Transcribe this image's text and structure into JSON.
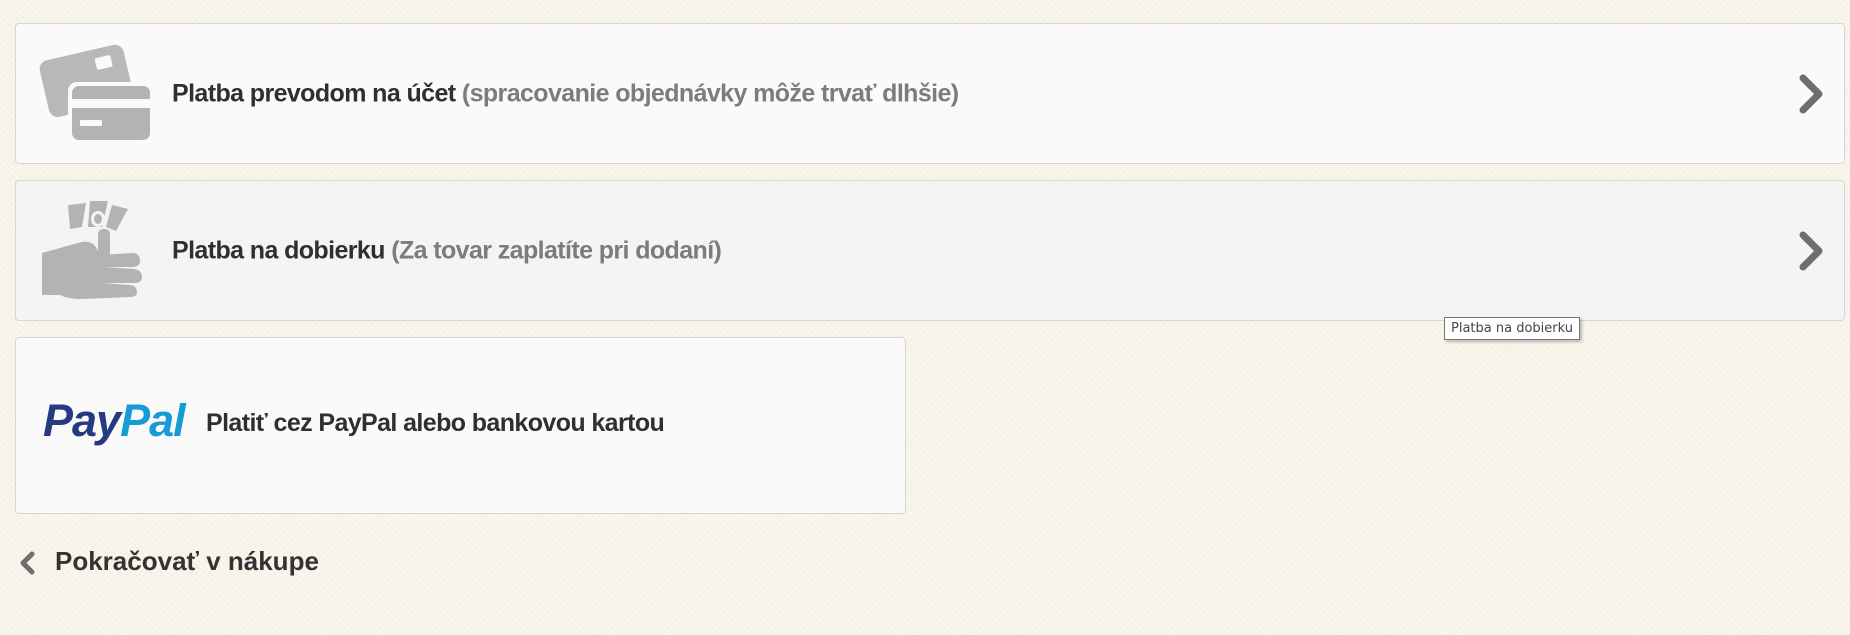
{
  "payment_options": [
    {
      "icon": "credit-card-icon",
      "label": "Platba prevodom na účet",
      "note": "(spracovanie objednávky môže trvať dlhšie)"
    },
    {
      "icon": "cash-hand-icon",
      "label": "Platba na dobierku",
      "note": "(Za tovar zaplatíte pri dodaní)"
    }
  ],
  "paypal": {
    "logo_pay": "Pay",
    "logo_pal": "Pal",
    "label": "Platiť cez PayPal alebo bankovou kartou"
  },
  "tooltip": {
    "text": "Platba na dobierku"
  },
  "back_link": {
    "label": "Pokračovať v nákupe",
    "icon": "chevron-left-icon"
  },
  "colors": {
    "background": "#f8f4ea",
    "card_background": "#fafafa",
    "icon_gray": "#b3b3b3",
    "chevron_gray": "#6e6e6e",
    "paypal_dark_blue": "#253b80",
    "paypal_light_blue": "#179bd7"
  }
}
